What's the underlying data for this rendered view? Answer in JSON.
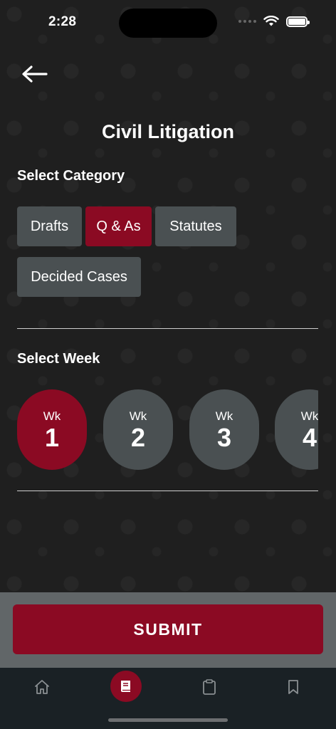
{
  "status_bar": {
    "time": "2:28"
  },
  "header": {
    "title": "Civil Litigation"
  },
  "category": {
    "label": "Select Category",
    "options": [
      {
        "label": "Drafts",
        "selected": false
      },
      {
        "label": "Q & As",
        "selected": true
      },
      {
        "label": "Statutes",
        "selected": false
      },
      {
        "label": "Decided Cases",
        "selected": false
      }
    ]
  },
  "week": {
    "label": "Select Week",
    "prefix": "Wk",
    "options": [
      {
        "number": "1",
        "selected": true
      },
      {
        "number": "2",
        "selected": false
      },
      {
        "number": "3",
        "selected": false
      },
      {
        "number": "4",
        "selected": false
      }
    ]
  },
  "submit": {
    "label": "SUBMIT"
  },
  "tab_bar": {
    "items": [
      {
        "icon": "home-icon",
        "active": false
      },
      {
        "icon": "book-icon",
        "active": true
      },
      {
        "icon": "clipboard-icon",
        "active": false
      },
      {
        "icon": "bookmark-icon",
        "active": false
      }
    ]
  },
  "colors": {
    "accent": "#8b0a23",
    "chip": "#4a5052",
    "background": "#1f1f1f",
    "tab_bar": "#1a2125"
  }
}
